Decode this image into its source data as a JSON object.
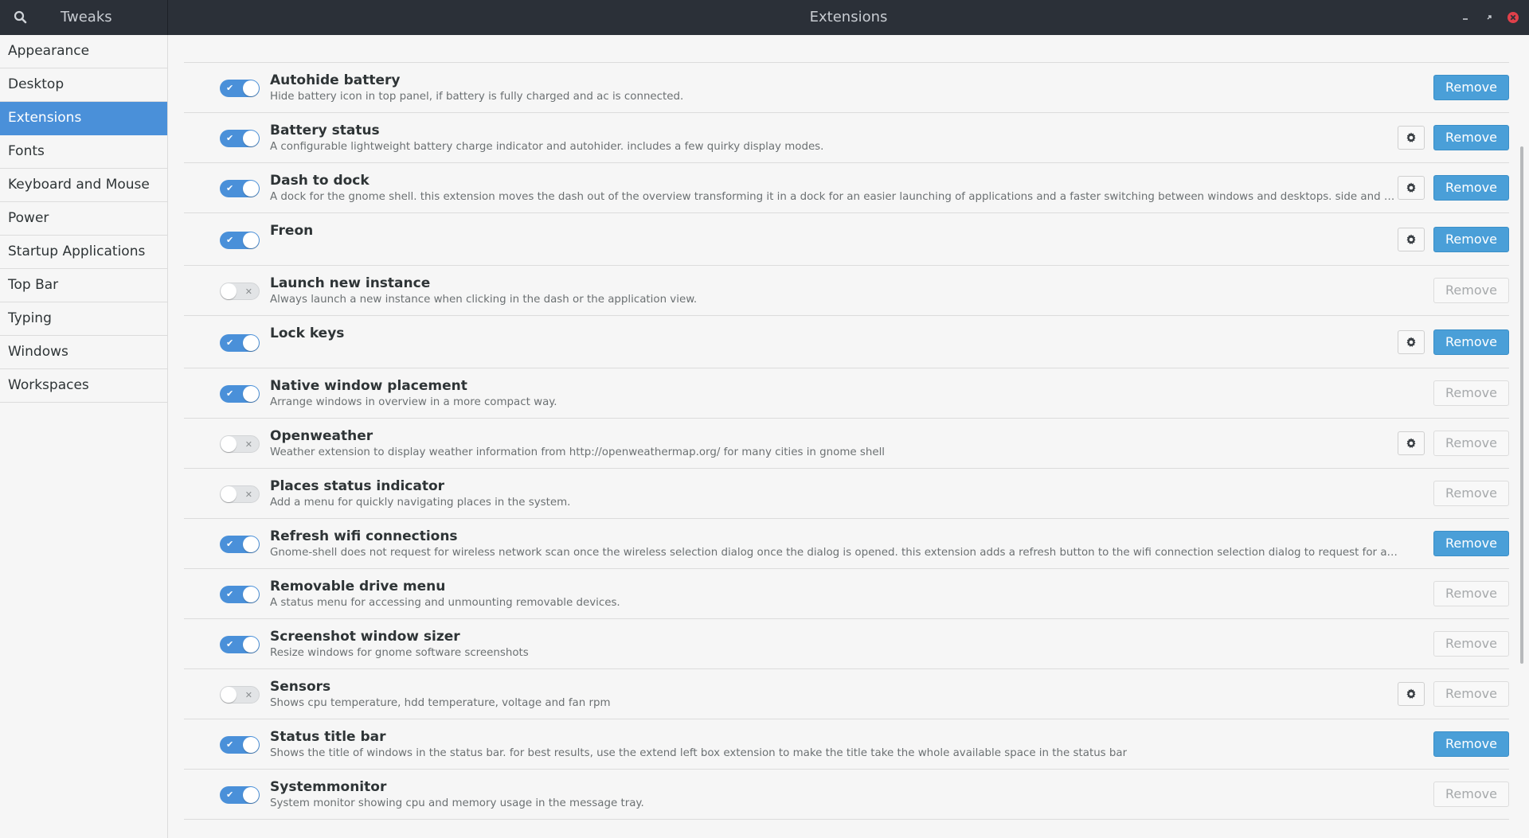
{
  "window": {
    "app_name": "Tweaks",
    "title": "Extensions"
  },
  "sidebar": {
    "items": [
      {
        "label": "Appearance",
        "selected": false
      },
      {
        "label": "Desktop",
        "selected": false
      },
      {
        "label": "Extensions",
        "selected": true
      },
      {
        "label": "Fonts",
        "selected": false
      },
      {
        "label": "Keyboard and Mouse",
        "selected": false
      },
      {
        "label": "Power",
        "selected": false
      },
      {
        "label": "Startup Applications",
        "selected": false
      },
      {
        "label": "Top Bar",
        "selected": false
      },
      {
        "label": "Typing",
        "selected": false
      },
      {
        "label": "Windows",
        "selected": false
      },
      {
        "label": "Workspaces",
        "selected": false
      }
    ]
  },
  "extensions": [
    {
      "name": "Autohide battery",
      "description": "Hide battery icon in top panel, if battery is fully charged and ac is connected.",
      "enabled": true,
      "has_settings": false,
      "remove_label": "Remove"
    },
    {
      "name": "Battery status",
      "description": "A configurable lightweight battery charge indicator and autohider. includes a few quirky display modes.",
      "enabled": true,
      "has_settings": true,
      "remove_label": "Remove"
    },
    {
      "name": "Dash to dock",
      "description": "A dock for the gnome shell. this extension moves the dash out of the overview transforming it in a dock for an easier launching of applications and a faster switching between windows and desktops. side and bottom placeme...",
      "enabled": true,
      "has_settings": true,
      "remove_label": "Remove"
    },
    {
      "name": "Freon",
      "description": "",
      "enabled": true,
      "has_settings": true,
      "remove_label": "Remove"
    },
    {
      "name": "Launch new instance",
      "description": "Always launch a new instance when clicking in the dash or the application view.",
      "enabled": false,
      "has_settings": false,
      "remove_label": "Remove"
    },
    {
      "name": "Lock keys",
      "description": "",
      "enabled": true,
      "has_settings": true,
      "remove_label": "Remove"
    },
    {
      "name": "Native window placement",
      "description": "Arrange windows in overview in a more compact way.",
      "enabled": true,
      "has_settings": false,
      "remove_label": "Remove"
    },
    {
      "name": "Openweather",
      "description": "Weather extension to display weather information from http://openweathermap.org/ for many cities in gnome shell",
      "enabled": false,
      "has_settings": true,
      "remove_label": "Remove"
    },
    {
      "name": "Places status indicator",
      "description": "Add a menu for quickly navigating places in the system.",
      "enabled": false,
      "has_settings": false,
      "remove_label": "Remove"
    },
    {
      "name": "Refresh wifi connections",
      "description": "Gnome-shell does not request for wireless network scan once the wireless selection dialog once the dialog is opened. this extension adds a refresh button to the wifi connection selection dialog to request for a network scan manual...",
      "enabled": true,
      "has_settings": false,
      "remove_label": "Remove"
    },
    {
      "name": "Removable drive menu",
      "description": "A status menu for accessing and unmounting removable devices.",
      "enabled": true,
      "has_settings": false,
      "remove_label": "Remove"
    },
    {
      "name": "Screenshot window sizer",
      "description": "Resize windows for gnome software screenshots",
      "enabled": true,
      "has_settings": false,
      "remove_label": "Remove"
    },
    {
      "name": "Sensors",
      "description": "Shows cpu temperature, hdd temperature, voltage and fan rpm",
      "enabled": false,
      "has_settings": true,
      "remove_label": "Remove"
    },
    {
      "name": "Status title bar",
      "description": "Shows the title of windows in the status bar. for best results, use the extend left box extension to make the title take the whole available space in the status bar",
      "enabled": true,
      "has_settings": false,
      "remove_label": "Remove"
    },
    {
      "name": "Systemmonitor",
      "description": "System monitor showing cpu and memory usage in the message tray.",
      "enabled": true,
      "has_settings": false,
      "remove_label": "Remove"
    }
  ],
  "remove_enabled_state": [
    "active",
    "active",
    "active",
    "active",
    "disabled",
    "active",
    "disabled",
    "disabled",
    "disabled",
    "active",
    "disabled",
    "disabled",
    "disabled",
    "active",
    "disabled"
  ],
  "icons": {
    "search": "search-icon",
    "minimize": "minimize-icon",
    "maximize": "maximize-icon",
    "close": "close-icon",
    "settings": "gear-icon",
    "toggle_on_mark": "✔",
    "toggle_off_mark": "✕"
  },
  "colors": {
    "accent": "#4a90d9",
    "remove_active": "#4a9fd8",
    "close_button": "#e0404a",
    "titlebar": "#2b3038"
  }
}
